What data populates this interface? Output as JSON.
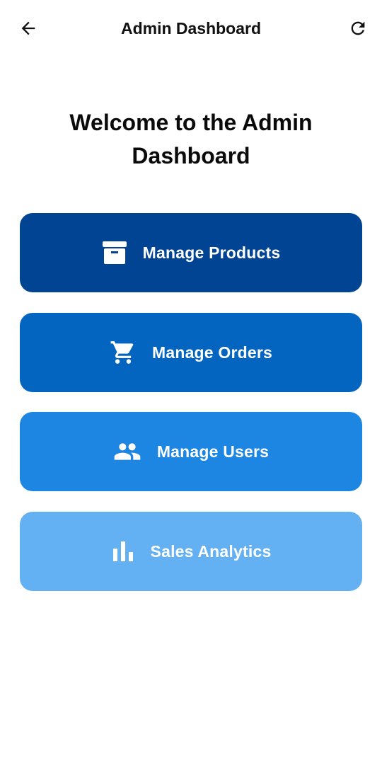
{
  "app_bar": {
    "title": "Admin Dashboard",
    "back_icon": "arrow-left-icon",
    "refresh_icon": "refresh-icon"
  },
  "welcome": {
    "text": "Welcome to the Admin Dashboard"
  },
  "actions": [
    {
      "label": "Manage Products",
      "icon": "archive-box-icon",
      "color": "#004493"
    },
    {
      "label": "Manage Orders",
      "icon": "shopping-cart-icon",
      "color": "#0465C0"
    },
    {
      "label": "Manage Users",
      "icon": "people-icon",
      "color": "#1C86E2"
    },
    {
      "label": "Sales Analytics",
      "icon": "bar-chart-icon",
      "color": "#63B1F3"
    }
  ]
}
